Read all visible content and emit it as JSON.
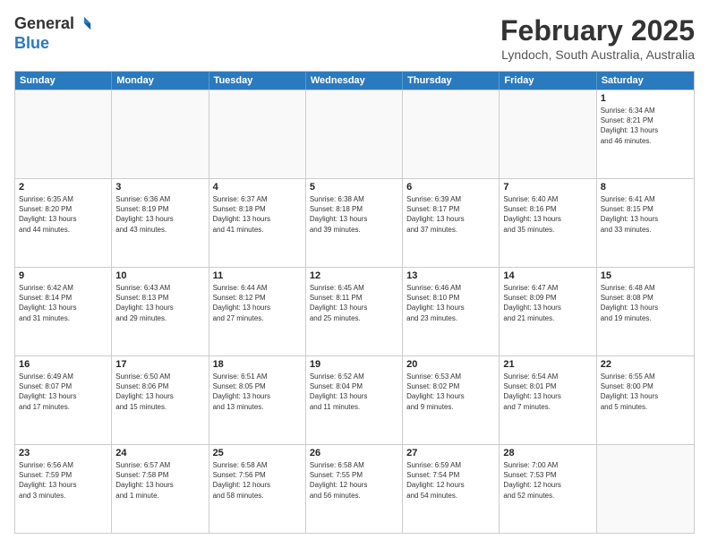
{
  "logo": {
    "line1": "General",
    "line2": "Blue"
  },
  "calendar": {
    "title": "February 2025",
    "subtitle": "Lyndoch, South Australia, Australia",
    "headers": [
      "Sunday",
      "Monday",
      "Tuesday",
      "Wednesday",
      "Thursday",
      "Friday",
      "Saturday"
    ],
    "weeks": [
      [
        {
          "day": "",
          "info": ""
        },
        {
          "day": "",
          "info": ""
        },
        {
          "day": "",
          "info": ""
        },
        {
          "day": "",
          "info": ""
        },
        {
          "day": "",
          "info": ""
        },
        {
          "day": "",
          "info": ""
        },
        {
          "day": "1",
          "info": "Sunrise: 6:34 AM\nSunset: 8:21 PM\nDaylight: 13 hours\nand 46 minutes."
        }
      ],
      [
        {
          "day": "2",
          "info": "Sunrise: 6:35 AM\nSunset: 8:20 PM\nDaylight: 13 hours\nand 44 minutes."
        },
        {
          "day": "3",
          "info": "Sunrise: 6:36 AM\nSunset: 8:19 PM\nDaylight: 13 hours\nand 43 minutes."
        },
        {
          "day": "4",
          "info": "Sunrise: 6:37 AM\nSunset: 8:18 PM\nDaylight: 13 hours\nand 41 minutes."
        },
        {
          "day": "5",
          "info": "Sunrise: 6:38 AM\nSunset: 8:18 PM\nDaylight: 13 hours\nand 39 minutes."
        },
        {
          "day": "6",
          "info": "Sunrise: 6:39 AM\nSunset: 8:17 PM\nDaylight: 13 hours\nand 37 minutes."
        },
        {
          "day": "7",
          "info": "Sunrise: 6:40 AM\nSunset: 8:16 PM\nDaylight: 13 hours\nand 35 minutes."
        },
        {
          "day": "8",
          "info": "Sunrise: 6:41 AM\nSunset: 8:15 PM\nDaylight: 13 hours\nand 33 minutes."
        }
      ],
      [
        {
          "day": "9",
          "info": "Sunrise: 6:42 AM\nSunset: 8:14 PM\nDaylight: 13 hours\nand 31 minutes."
        },
        {
          "day": "10",
          "info": "Sunrise: 6:43 AM\nSunset: 8:13 PM\nDaylight: 13 hours\nand 29 minutes."
        },
        {
          "day": "11",
          "info": "Sunrise: 6:44 AM\nSunset: 8:12 PM\nDaylight: 13 hours\nand 27 minutes."
        },
        {
          "day": "12",
          "info": "Sunrise: 6:45 AM\nSunset: 8:11 PM\nDaylight: 13 hours\nand 25 minutes."
        },
        {
          "day": "13",
          "info": "Sunrise: 6:46 AM\nSunset: 8:10 PM\nDaylight: 13 hours\nand 23 minutes."
        },
        {
          "day": "14",
          "info": "Sunrise: 6:47 AM\nSunset: 8:09 PM\nDaylight: 13 hours\nand 21 minutes."
        },
        {
          "day": "15",
          "info": "Sunrise: 6:48 AM\nSunset: 8:08 PM\nDaylight: 13 hours\nand 19 minutes."
        }
      ],
      [
        {
          "day": "16",
          "info": "Sunrise: 6:49 AM\nSunset: 8:07 PM\nDaylight: 13 hours\nand 17 minutes."
        },
        {
          "day": "17",
          "info": "Sunrise: 6:50 AM\nSunset: 8:06 PM\nDaylight: 13 hours\nand 15 minutes."
        },
        {
          "day": "18",
          "info": "Sunrise: 6:51 AM\nSunset: 8:05 PM\nDaylight: 13 hours\nand 13 minutes."
        },
        {
          "day": "19",
          "info": "Sunrise: 6:52 AM\nSunset: 8:04 PM\nDaylight: 13 hours\nand 11 minutes."
        },
        {
          "day": "20",
          "info": "Sunrise: 6:53 AM\nSunset: 8:02 PM\nDaylight: 13 hours\nand 9 minutes."
        },
        {
          "day": "21",
          "info": "Sunrise: 6:54 AM\nSunset: 8:01 PM\nDaylight: 13 hours\nand 7 minutes."
        },
        {
          "day": "22",
          "info": "Sunrise: 6:55 AM\nSunset: 8:00 PM\nDaylight: 13 hours\nand 5 minutes."
        }
      ],
      [
        {
          "day": "23",
          "info": "Sunrise: 6:56 AM\nSunset: 7:59 PM\nDaylight: 13 hours\nand 3 minutes."
        },
        {
          "day": "24",
          "info": "Sunrise: 6:57 AM\nSunset: 7:58 PM\nDaylight: 13 hours\nand 1 minute."
        },
        {
          "day": "25",
          "info": "Sunrise: 6:58 AM\nSunset: 7:56 PM\nDaylight: 12 hours\nand 58 minutes."
        },
        {
          "day": "26",
          "info": "Sunrise: 6:58 AM\nSunset: 7:55 PM\nDaylight: 12 hours\nand 56 minutes."
        },
        {
          "day": "27",
          "info": "Sunrise: 6:59 AM\nSunset: 7:54 PM\nDaylight: 12 hours\nand 54 minutes."
        },
        {
          "day": "28",
          "info": "Sunrise: 7:00 AM\nSunset: 7:53 PM\nDaylight: 12 hours\nand 52 minutes."
        },
        {
          "day": "",
          "info": ""
        }
      ]
    ]
  }
}
